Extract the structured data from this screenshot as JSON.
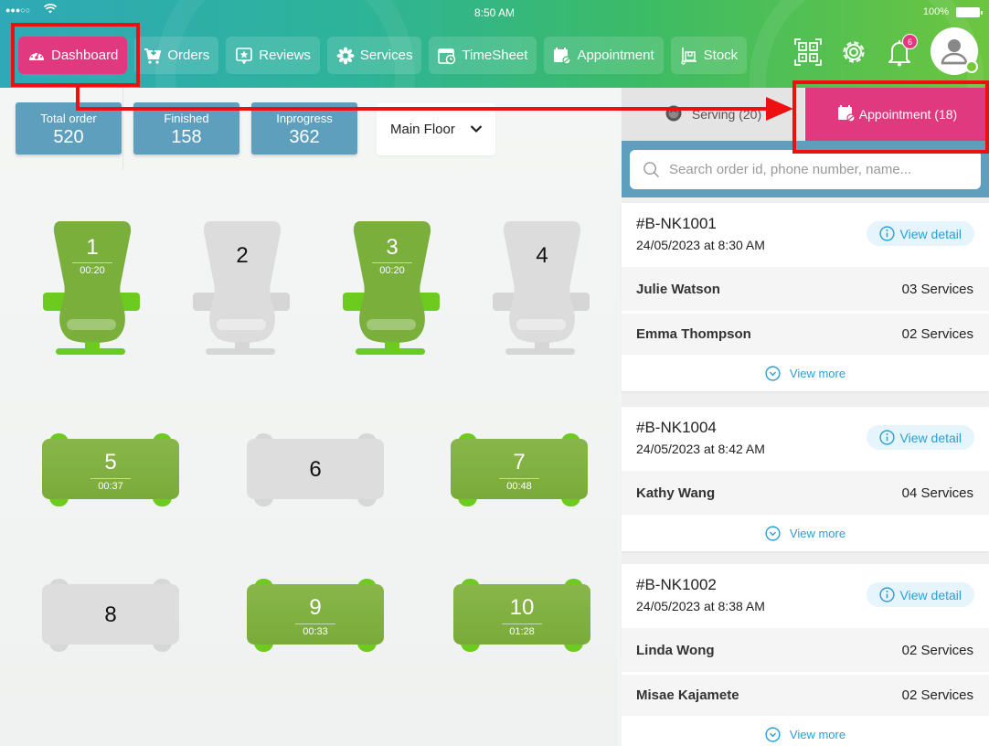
{
  "status_bar": {
    "signal": "●●●○○",
    "time": "8:50 AM",
    "battery": "100%"
  },
  "nav": {
    "items": [
      {
        "label": "Dashboard",
        "icon": "dashboard-gauge-icon",
        "active": true
      },
      {
        "label": "Orders",
        "icon": "cart-icon",
        "active": false
      },
      {
        "label": "Reviews",
        "icon": "star-review-icon",
        "active": false
      },
      {
        "label": "Services",
        "icon": "flower-icon",
        "active": false
      },
      {
        "label": "TimeSheet",
        "icon": "calendar-clock-icon",
        "active": false
      },
      {
        "label": "Appointment",
        "icon": "calendar-icon",
        "active": false
      },
      {
        "label": "Stock",
        "icon": "stock-trolley-icon",
        "active": false
      }
    ],
    "actions": {
      "qr": "qr-code-icon",
      "settings": "gear-icon",
      "notifications": "bell-icon",
      "notification_count": "6",
      "profile": "avatar-icon"
    }
  },
  "stats": [
    {
      "label": "Total order",
      "value": "520"
    },
    {
      "label": "Finished",
      "value": "158"
    },
    {
      "label": "Inprogress",
      "value": "362"
    }
  ],
  "floor_select": {
    "value": "Main Floor"
  },
  "chairs": [
    {
      "number": "1",
      "time": "00:20",
      "status": "busy"
    },
    {
      "number": "2",
      "time": "",
      "status": "free"
    },
    {
      "number": "3",
      "time": "00:20",
      "status": "busy"
    },
    {
      "number": "4",
      "time": "",
      "status": "free"
    }
  ],
  "tables": [
    {
      "number": "5",
      "time": "00:37",
      "status": "busy"
    },
    {
      "number": "6",
      "time": "",
      "status": "free"
    },
    {
      "number": "7",
      "time": "00:48",
      "status": "busy"
    },
    {
      "number": "8",
      "time": "",
      "status": "free"
    },
    {
      "number": "9",
      "time": "00:33",
      "status": "busy"
    },
    {
      "number": "10",
      "time": "01:28",
      "status": "busy"
    }
  ],
  "panel": {
    "tabs": {
      "serving": "Serving (20)",
      "appointment": "Appointment (18)"
    },
    "search": {
      "placeholder": "Search order id, phone number, name...",
      "value": ""
    },
    "view_detail_label": "View detail",
    "view_more_label": "View more",
    "orders": [
      {
        "id": "#B-NK1001",
        "date": "24/05/2023 at 8:30 AM",
        "customers": [
          {
            "name": "Julie Watson",
            "services": "03 Services"
          },
          {
            "name": "Emma Thompson",
            "services": "02 Services"
          }
        ]
      },
      {
        "id": "#B-NK1004",
        "date": "24/05/2023 at 8:42 AM",
        "customers": [
          {
            "name": "Kathy Wang",
            "services": "04 Services"
          }
        ]
      },
      {
        "id": "#B-NK1002",
        "date": "24/05/2023 at 8:38 AM",
        "customers": [
          {
            "name": "Linda Wong",
            "services": "02 Services"
          },
          {
            "name": "Misae Kajamete",
            "services": "02 Services"
          }
        ]
      }
    ]
  },
  "colors": {
    "accent_pink": "#e0397f",
    "stat_blue": "#5d9fbc",
    "busy_green": "#7aab3a",
    "link_blue": "#2a9fd6",
    "annotation_red": "#ee1010"
  }
}
